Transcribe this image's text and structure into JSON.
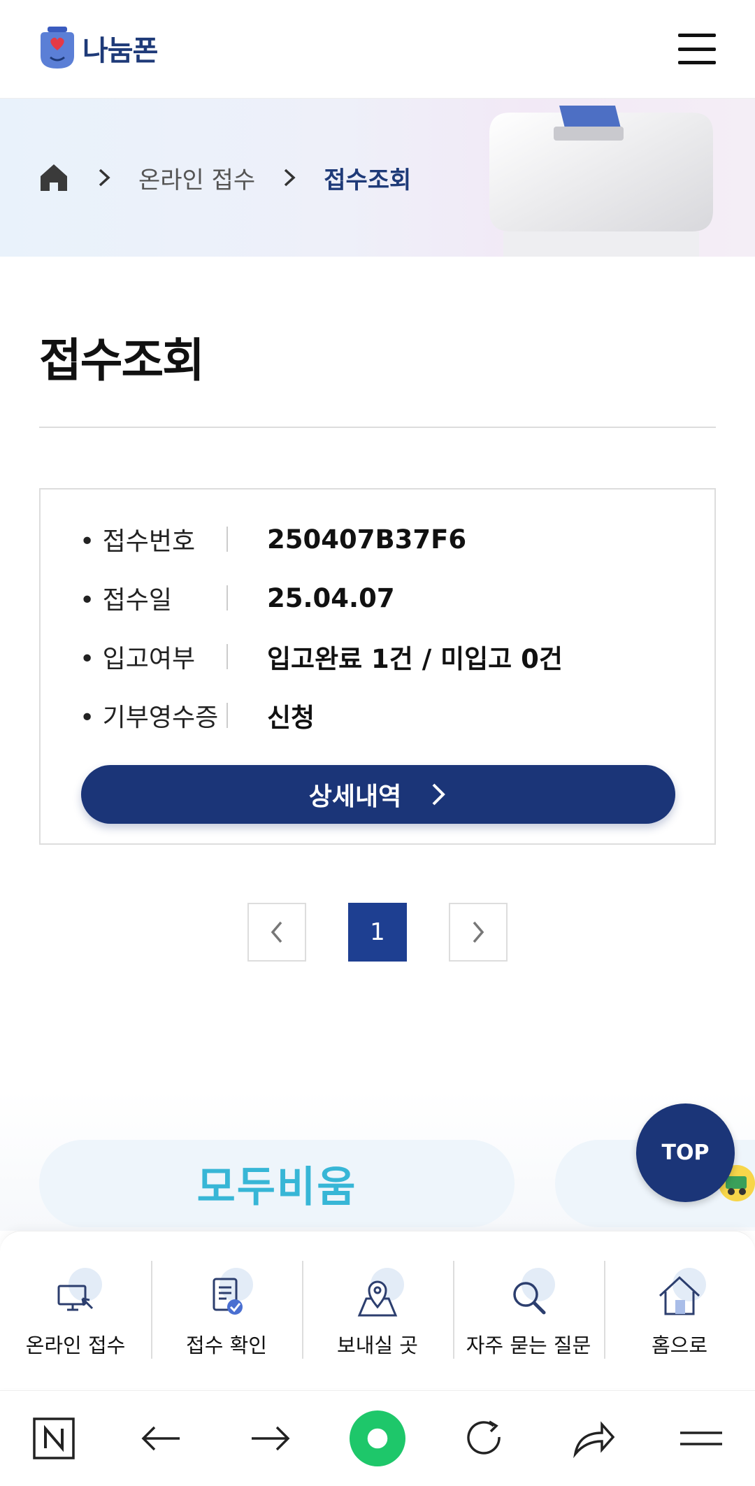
{
  "header": {
    "logo_text": "나눔폰"
  },
  "breadcrumb": {
    "items": [
      "온라인 접수",
      "접수조회"
    ]
  },
  "page": {
    "title": "접수조회"
  },
  "receipt": {
    "rows": [
      {
        "label": "• 접수번호",
        "value": "250407B37F6"
      },
      {
        "label": "• 접수일",
        "value": "25.04.07"
      },
      {
        "label": "• 입고여부",
        "value": "입고완료 1건 / 미입고 0건"
      },
      {
        "label": "• 기부영수증",
        "value": "신청"
      }
    ],
    "detail_button": "상세내역"
  },
  "pagination": {
    "current": "1"
  },
  "promo": {
    "banner_text": "모두비움"
  },
  "top_button": "TOP",
  "quick_nav": [
    {
      "label": "온라인 접수",
      "icon": "computer-icon"
    },
    {
      "label": "접수 확인",
      "icon": "clipboard-check-icon"
    },
    {
      "label": "보내실 곳",
      "icon": "map-pin-icon"
    },
    {
      "label": "자주 묻는 질문",
      "icon": "search-icon"
    },
    {
      "label": "홈으로",
      "icon": "house-icon"
    }
  ],
  "colors": {
    "brand": "#1b3578",
    "accent": "#37b6d6",
    "browser_home": "#1ec76a"
  }
}
